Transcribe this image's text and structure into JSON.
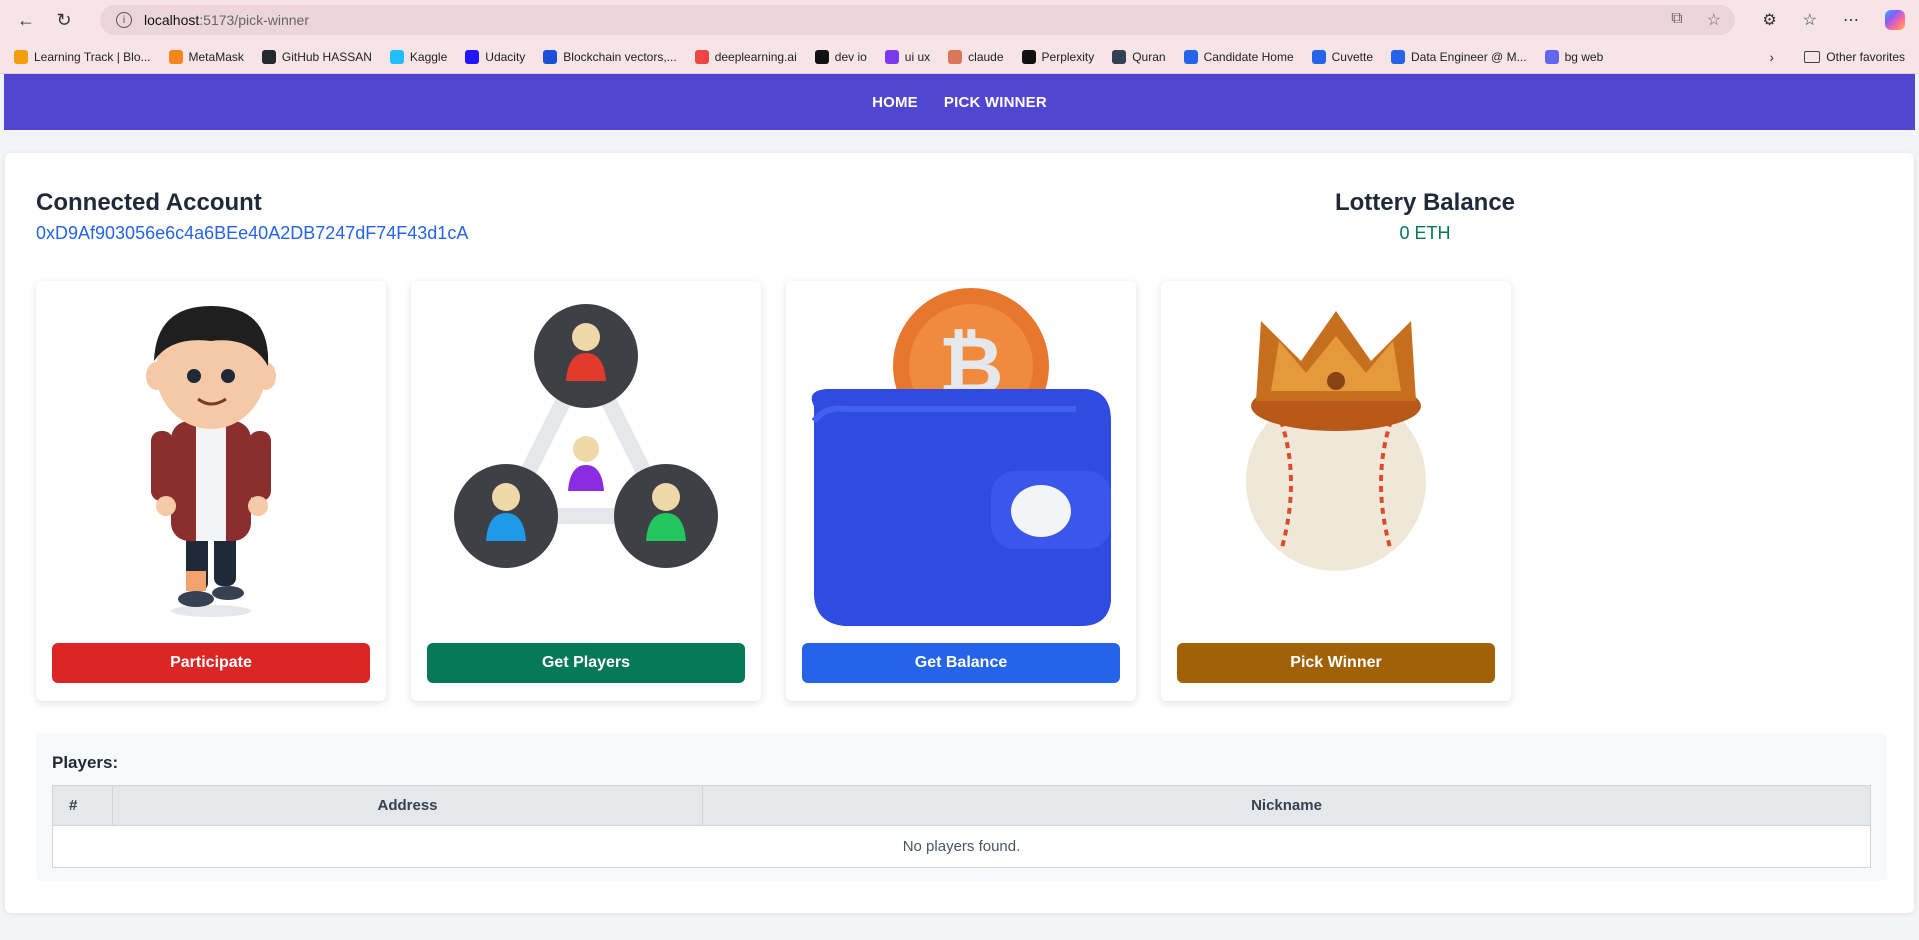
{
  "browser": {
    "url_host": "localhost",
    "url_path": ":5173/pick-winner",
    "bookmarks": [
      {
        "label": "Learning Track | Blo...",
        "color": "#f59e0b"
      },
      {
        "label": "MetaMask",
        "color": "#f6851b"
      },
      {
        "label": "GitHub HASSAN",
        "color": "#24292f"
      },
      {
        "label": "Kaggle",
        "color": "#20beff"
      },
      {
        "label": "Udacity",
        "color": "#2015ff"
      },
      {
        "label": "Blockchain vectors,...",
        "color": "#1d4ed8"
      },
      {
        "label": "deeplearning.ai",
        "color": "#ef4444"
      },
      {
        "label": "dev io",
        "color": "#111111"
      },
      {
        "label": "ui ux",
        "color": "#7c3aed"
      },
      {
        "label": "claude",
        "color": "#d97757"
      },
      {
        "label": "Perplexity",
        "color": "#111111"
      },
      {
        "label": "Quran",
        "color": "#334155"
      },
      {
        "label": "Candidate Home",
        "color": "#2563eb"
      },
      {
        "label": "Cuvette",
        "color": "#2563eb"
      },
      {
        "label": "Data Engineer @ M...",
        "color": "#2563eb"
      },
      {
        "label": "bg web",
        "color": "#6366f1"
      }
    ],
    "other_favorites": "Other favorites"
  },
  "nav": {
    "home": "HOME",
    "pick_winner": "PICK WINNER"
  },
  "account": {
    "title": "Connected Account",
    "address": "0xD9Af903056e6c4a6BEe40A2DB7247dF74F43d1cA"
  },
  "balance": {
    "title": "Lottery Balance",
    "value": "0 ETH"
  },
  "actions": [
    {
      "label": "Participate",
      "color": "#dc2626",
      "art": "boy-character"
    },
    {
      "label": "Get Players",
      "color": "#047857",
      "art": "network-people"
    },
    {
      "label": "Get Balance",
      "color": "#2563eb",
      "art": "bitcoin-wallet"
    },
    {
      "label": "Pick Winner",
      "color": "#a16207",
      "art": "crowned-ball"
    }
  ],
  "players": {
    "label": "Players:",
    "columns": [
      "#",
      "Address",
      "Nickname"
    ],
    "empty_text": "No players found."
  }
}
